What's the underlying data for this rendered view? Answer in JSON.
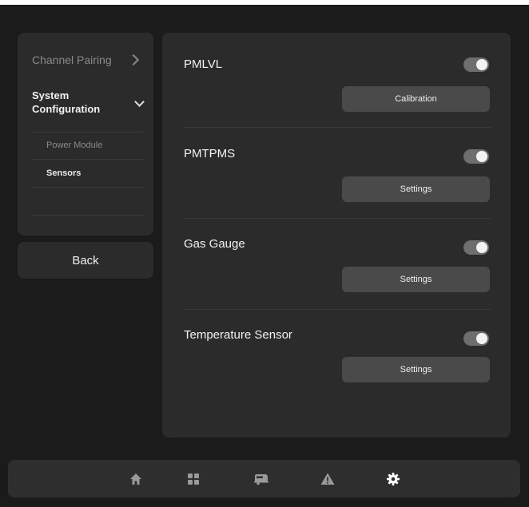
{
  "sidebar": {
    "channel_pairing": "Channel Pairing",
    "system_configuration_line1": "System",
    "system_configuration_line2": "Configuration",
    "items": [
      {
        "label": "Power Module"
      },
      {
        "label": "Sensors"
      }
    ],
    "back_label": "Back"
  },
  "main": {
    "sections": [
      {
        "label": "PMLVL",
        "toggle_on": true,
        "button_label": "Calibration"
      },
      {
        "label": "PMTPMS",
        "toggle_on": true,
        "button_label": "Settings"
      },
      {
        "label": "Gas Gauge",
        "toggle_on": true,
        "button_label": "Settings"
      },
      {
        "label": "Temperature Sensor",
        "toggle_on": true,
        "button_label": "Settings"
      }
    ]
  },
  "nav": {
    "icons": [
      "home-icon",
      "grid-icon",
      "rv-icon",
      "warning-icon",
      "gear-icon"
    ],
    "active": "gear-icon"
  },
  "colors": {
    "background": "#1b1b1b",
    "panel": "#2b2b2b",
    "button": "#4a4a4a",
    "toggle_track": "#6e6e6e",
    "text": "#f2f2f2",
    "muted_text": "#8a8a8a"
  }
}
